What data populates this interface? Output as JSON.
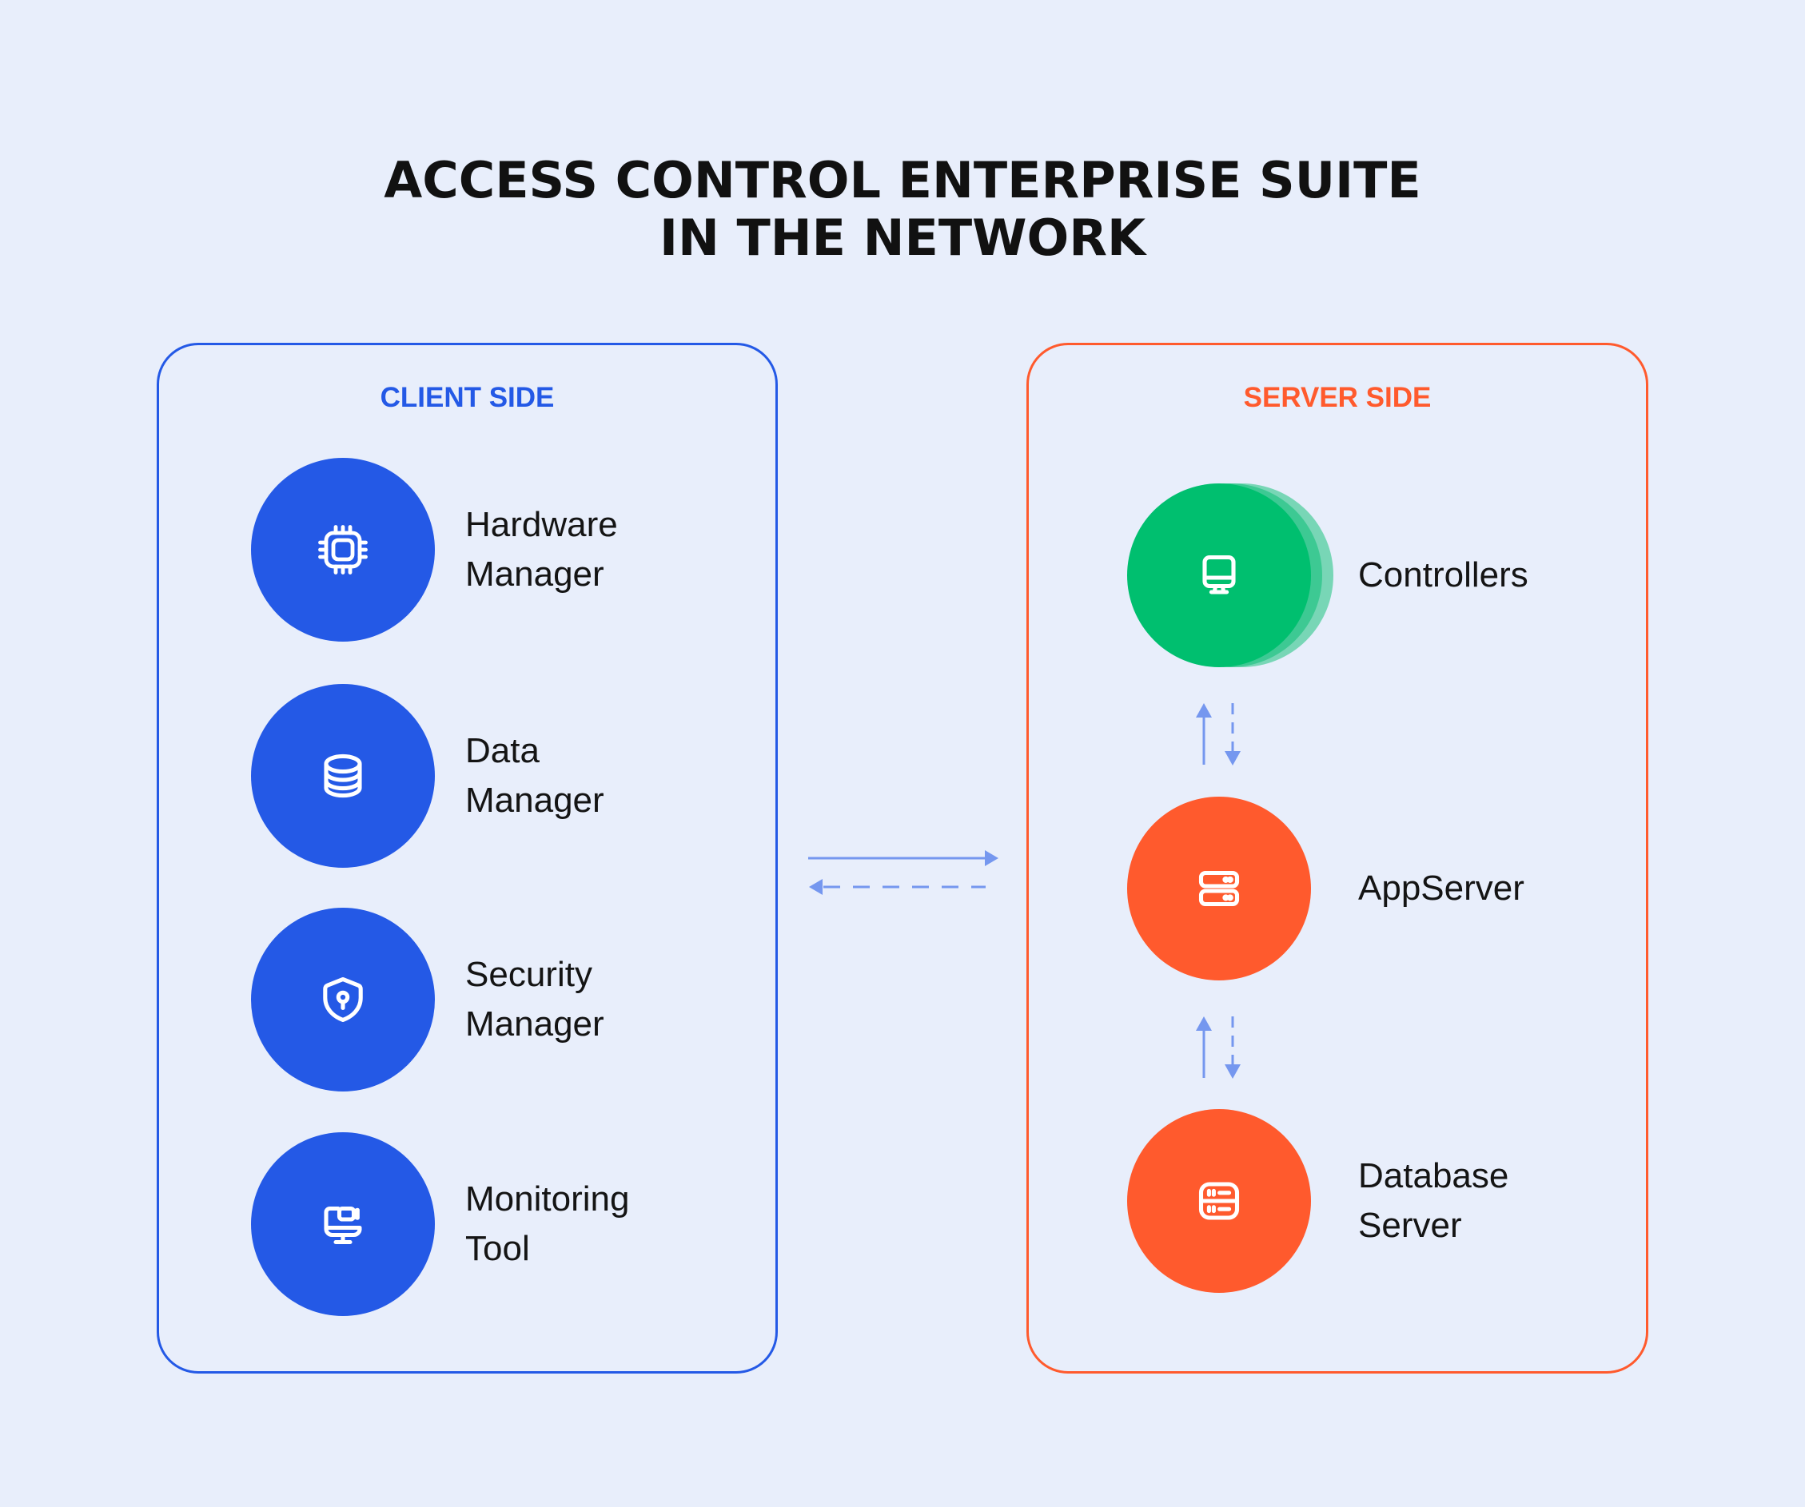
{
  "title": {
    "line1": "ACCESS CONTROL ENTERPRISE SUITE",
    "line2": "IN THE NETWORK"
  },
  "colors": {
    "background": "#e8eefb",
    "client_accent": "#2459e6",
    "server_accent": "#ff5a2d",
    "controller_green": "#00bf6f",
    "arrow": "#7597ef"
  },
  "client_side": {
    "heading": "CLIENT SIDE",
    "items": [
      {
        "icon": "cpu-chip-icon",
        "line1": "Hardware",
        "line2": "Manager"
      },
      {
        "icon": "database-icon",
        "line1": "Data",
        "line2": "Manager"
      },
      {
        "icon": "shield-keyhole-icon",
        "line1": "Security",
        "line2": "Manager"
      },
      {
        "icon": "monitor-camera-icon",
        "line1": "Monitoring",
        "line2": "Tool"
      }
    ]
  },
  "server_side": {
    "heading": "SERVER SIDE",
    "items": [
      {
        "icon": "desktop-monitor-icon",
        "line1": "Controllers",
        "line2": ""
      },
      {
        "icon": "server-rack-icon",
        "line1": "AppServer",
        "line2": ""
      },
      {
        "icon": "database-server-icon",
        "line1": "Database",
        "line2": "Server"
      }
    ]
  },
  "connections": [
    {
      "from": "client_side",
      "to": "server_side",
      "style": "solid"
    },
    {
      "from": "server_side",
      "to": "client_side",
      "style": "dashed"
    },
    {
      "from": "AppServer",
      "to": "Controllers",
      "style": "solid"
    },
    {
      "from": "Controllers",
      "to": "AppServer",
      "style": "dashed"
    },
    {
      "from": "Database Server",
      "to": "AppServer",
      "style": "solid"
    },
    {
      "from": "AppServer",
      "to": "Database Server",
      "style": "dashed"
    }
  ]
}
